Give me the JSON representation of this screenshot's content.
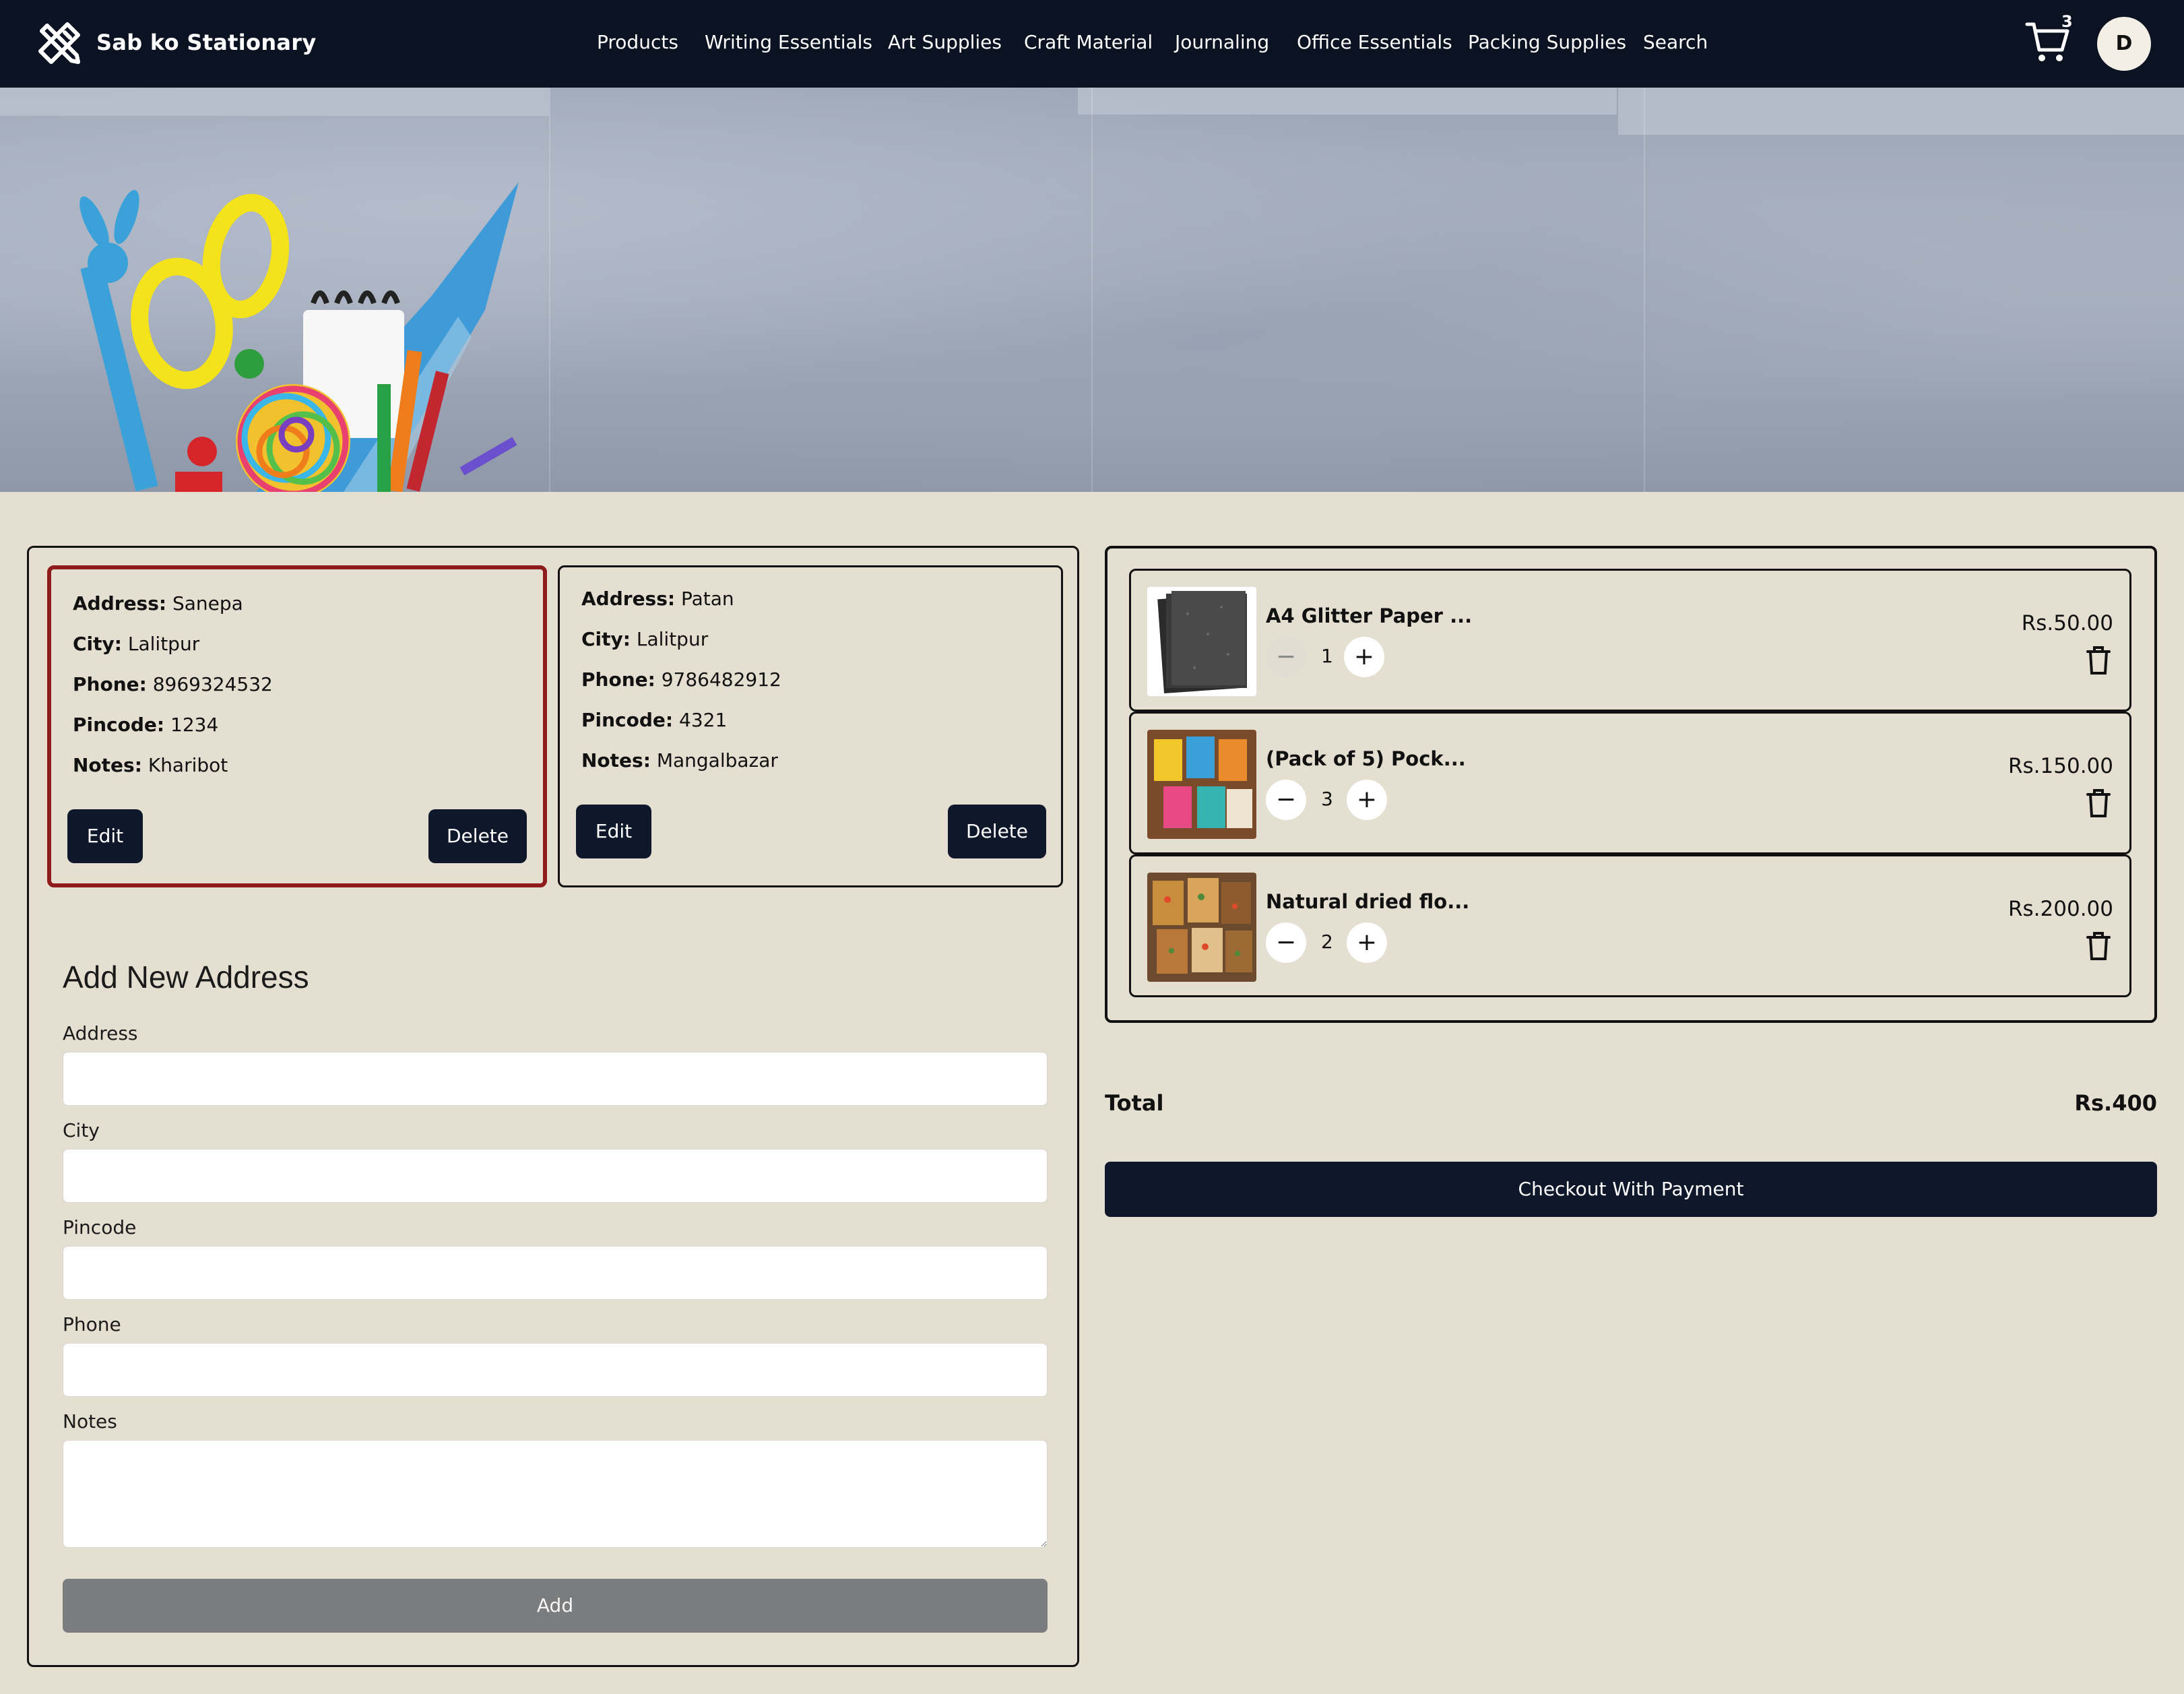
{
  "brand": {
    "name": "Sab ko Stationary"
  },
  "nav": {
    "items": [
      "Products",
      "Writing Essentials",
      "Art Supplies",
      "Craft Material",
      "Journaling",
      "Office Essentials",
      "Packing Supplies",
      "Search"
    ],
    "cart_count": "3",
    "avatar_initial": "D"
  },
  "addresses": [
    {
      "address_label": "Address:",
      "address": "Sanepa",
      "city_label": "City:",
      "city": "Lalitpur",
      "phone_label": "Phone:",
      "phone": "8969324532",
      "pincode_label": "Pincode:",
      "pincode": "1234",
      "notes_label": "Notes:",
      "notes": "Kharibot",
      "edit": "Edit",
      "delete": "Delete",
      "selected": true
    },
    {
      "address_label": "Address:",
      "address": "Patan",
      "city_label": "City:",
      "city": "Lalitpur",
      "phone_label": "Phone:",
      "phone": "9786482912",
      "pincode_label": "Pincode:",
      "pincode": "4321",
      "notes_label": "Notes:",
      "notes": "Mangalbazar",
      "edit": "Edit",
      "delete": "Delete",
      "selected": false
    }
  ],
  "form": {
    "title": "Add New Address",
    "labels": {
      "address": "Address",
      "city": "City",
      "pincode": "Pincode",
      "phone": "Phone",
      "notes": "Notes"
    },
    "values": {
      "address": "",
      "city": "",
      "pincode": "",
      "phone": "",
      "notes": ""
    },
    "submit": "Add"
  },
  "cart": {
    "items": [
      {
        "name": "A4 Glitter Paper ...",
        "qty": "1",
        "price": "Rs.50.00",
        "minus": "−",
        "plus": "+"
      },
      {
        "name": "(Pack of 5) Pock...",
        "qty": "3",
        "price": "Rs.150.00",
        "minus": "−",
        "plus": "+"
      },
      {
        "name": "Natural dried flo...",
        "qty": "2",
        "price": "Rs.200.00",
        "minus": "−",
        "plus": "+"
      }
    ],
    "total_label": "Total",
    "total_value": "Rs.400",
    "checkout": "Checkout With Payment"
  },
  "colors": {
    "nav_bg": "#0b1322",
    "page_bg": "#e5dfd2",
    "selected_border": "#8e1c1c",
    "button_dark": "#0f172a",
    "button_disabled": "#7b7c7e"
  },
  "icons": [
    "logo-icon",
    "cart-icon",
    "trash-icon",
    "minus-icon",
    "plus-icon"
  ]
}
